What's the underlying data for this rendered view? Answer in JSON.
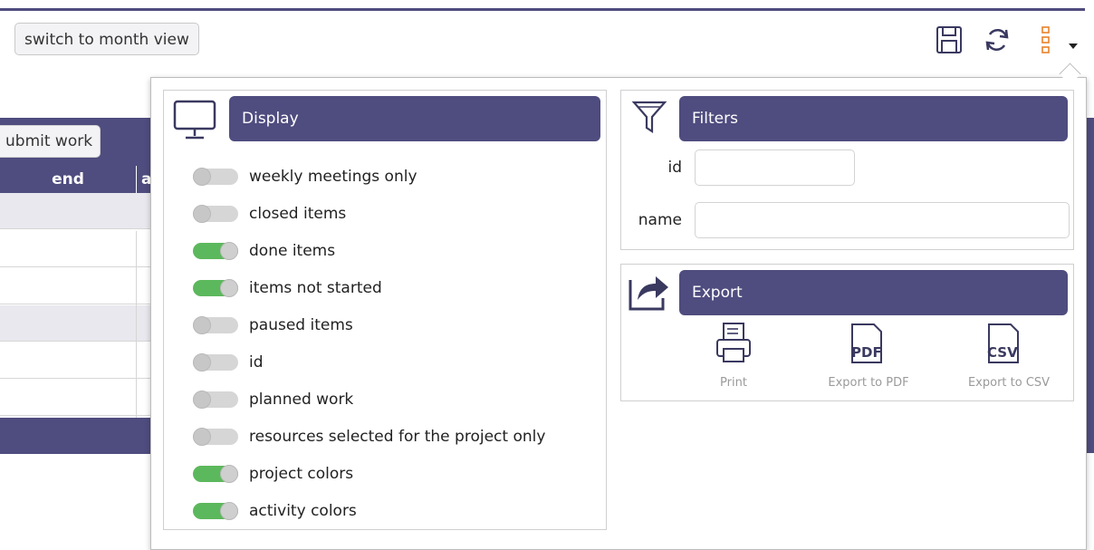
{
  "toolbar": {
    "month_view_label": "switch to month view",
    "icons": [
      "save-icon",
      "refresh-icon",
      "menu-icon",
      "dropdown-arrow-icon"
    ],
    "accent_color": "#4f4c7f",
    "menu_icon_color": "#e8822a"
  },
  "background_table": {
    "submit_label": "ubmit work",
    "col_end": "end",
    "col_next": "a"
  },
  "display": {
    "title": "Display",
    "icon": "monitor-icon",
    "toggles": [
      {
        "label": "weekly meetings only",
        "on": false
      },
      {
        "label": "closed items",
        "on": false
      },
      {
        "label": "done items",
        "on": true
      },
      {
        "label": "items not started",
        "on": true
      },
      {
        "label": "paused items",
        "on": false
      },
      {
        "label": "id",
        "on": false
      },
      {
        "label": "planned work",
        "on": false
      },
      {
        "label": "resources selected for the project only",
        "on": false
      },
      {
        "label": "project colors",
        "on": true
      },
      {
        "label": "activity colors",
        "on": true
      }
    ],
    "on_color": "#5cb85c",
    "off_color": "#d6d6d6"
  },
  "filters": {
    "title": "Filters",
    "icon": "filter-icon",
    "id_label": "id",
    "id_value": "",
    "name_label": "name",
    "name_value": ""
  },
  "export": {
    "title": "Export",
    "icon": "share-icon",
    "print_label": "Print",
    "pdf_label": "Export to PDF",
    "pdf_badge": "PDF",
    "csv_label": "Export to CSV",
    "csv_badge": "CSV"
  }
}
